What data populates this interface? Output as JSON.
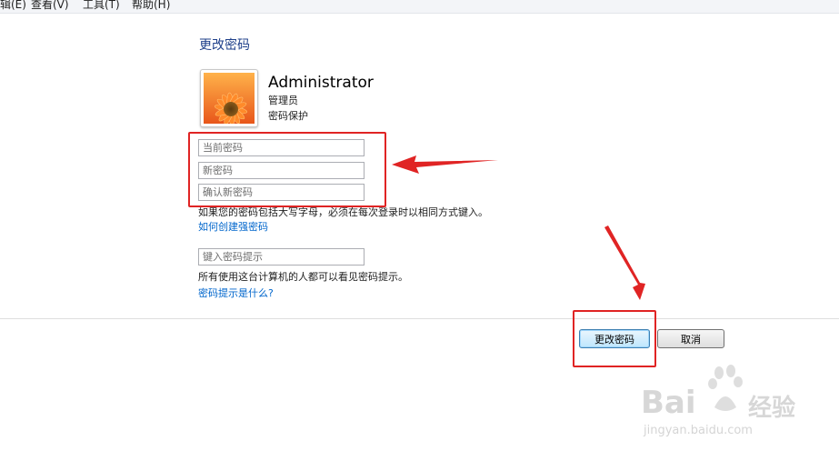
{
  "menu": {
    "items": [
      "辑(E)",
      "查看(V)",
      "工具(T)",
      "帮助(H)"
    ]
  },
  "page": {
    "title": "更改密码"
  },
  "user": {
    "name": "Administrator",
    "role": "管理员",
    "protection": "密码保护"
  },
  "form": {
    "current_password_placeholder": "当前密码",
    "new_password_placeholder": "新密码",
    "confirm_password_placeholder": "确认新密码",
    "case_notice": "如果您的密码包括大写字母，必须在每次登录时以相同方式键入。",
    "strong_password_link": "如何创建强密码",
    "hint_placeholder": "键入密码提示",
    "hint_notice": "所有使用这台计算机的人都可以看见密码提示。",
    "hint_link": "密码提示是什么?"
  },
  "buttons": {
    "change_password": "更改密码",
    "cancel": "取消"
  },
  "watermark": {
    "brand": "Bai",
    "brand_cn": "经验",
    "url": "jingyan.baidu.com"
  },
  "colors": {
    "annotation_red": "#e02424",
    "link_blue": "#0066cc",
    "title_blue": "#1e3f8a"
  }
}
